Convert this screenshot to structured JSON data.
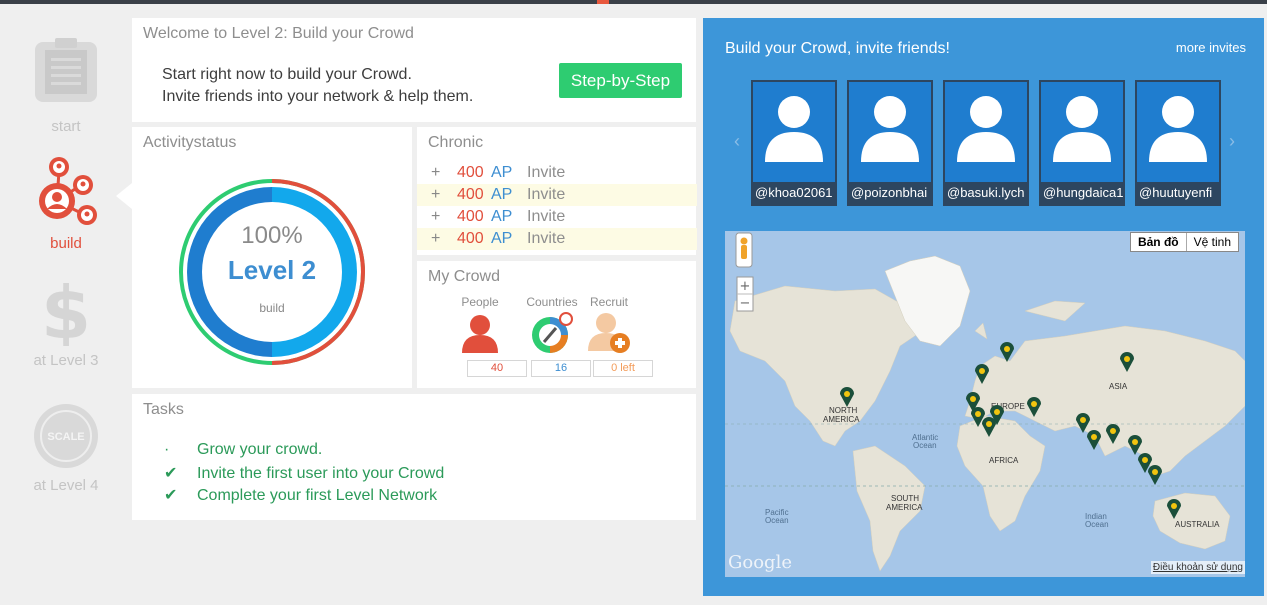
{
  "sidebar": {
    "start": "start",
    "build": "build",
    "level3": "at Level 3",
    "level4": "at Level 4",
    "scale_badge": "SCALE"
  },
  "welcome": {
    "title": "Welcome to Level 2: Build your Crowd",
    "line1": "Start right now to build your Crowd.",
    "line2": "Invite friends into your network & help them.",
    "button": "Step-by-Step"
  },
  "activity": {
    "title": "Activitystatus",
    "percent": "100%",
    "level": "Level 2",
    "stage": "build",
    "progress": 1.0
  },
  "chronic": {
    "title": "Chronic",
    "rows": [
      {
        "sign": "+",
        "points": "400",
        "unit": "AP",
        "action": "Invite"
      },
      {
        "sign": "+",
        "points": "400",
        "unit": "AP",
        "action": "Invite"
      },
      {
        "sign": "+",
        "points": "400",
        "unit": "AP",
        "action": "Invite"
      },
      {
        "sign": "+",
        "points": "400",
        "unit": "AP",
        "action": "Invite"
      }
    ]
  },
  "crowd": {
    "title": "My Crowd",
    "people_label": "People",
    "countries_label": "Countries",
    "recruit_label": "Recruit",
    "people_value": "40",
    "countries_value": "16",
    "recruit_value": "0 left"
  },
  "tasks": {
    "title": "Tasks",
    "items": [
      {
        "mark": "·",
        "text": "Grow your crowd."
      },
      {
        "mark": "✔",
        "text": "Invite the first user into your Crowd"
      },
      {
        "mark": "✔",
        "text": "Complete your first Level Network"
      }
    ]
  },
  "invite": {
    "title": "Build your Crowd, invite friends!",
    "more": "more invites",
    "prev": "‹",
    "next": "›",
    "friends": [
      "@khoa02061",
      "@poizonbhai",
      "@basuki.lych",
      "@hungdaica1",
      "@huutuyenfi"
    ]
  },
  "map": {
    "type_map": "Bản đồ",
    "type_sat": "Vệ tinh",
    "zoom_in": "+",
    "zoom_out": "−",
    "terms": "Điều khoản sử dụng",
    "logo": "Google",
    "labels": {
      "north_america": [
        "NORTH",
        "AMERICA"
      ],
      "europe": "EUROPE",
      "asia": "ASIA",
      "africa": "AFRICA",
      "south_america": [
        "SOUTH",
        "AMERICA"
      ],
      "australia": "AUSTRALIA",
      "atlantic": [
        "Atlantic",
        "Ocean"
      ],
      "pacific": [
        "Pacific",
        "Ocean"
      ],
      "indian": [
        "Indian",
        "Ocean"
      ]
    }
  },
  "colors": {
    "green": "#2ecc71",
    "red": "#e14f3c",
    "blue": "#3d8ed1",
    "panel_blue": "#3d96d9"
  }
}
